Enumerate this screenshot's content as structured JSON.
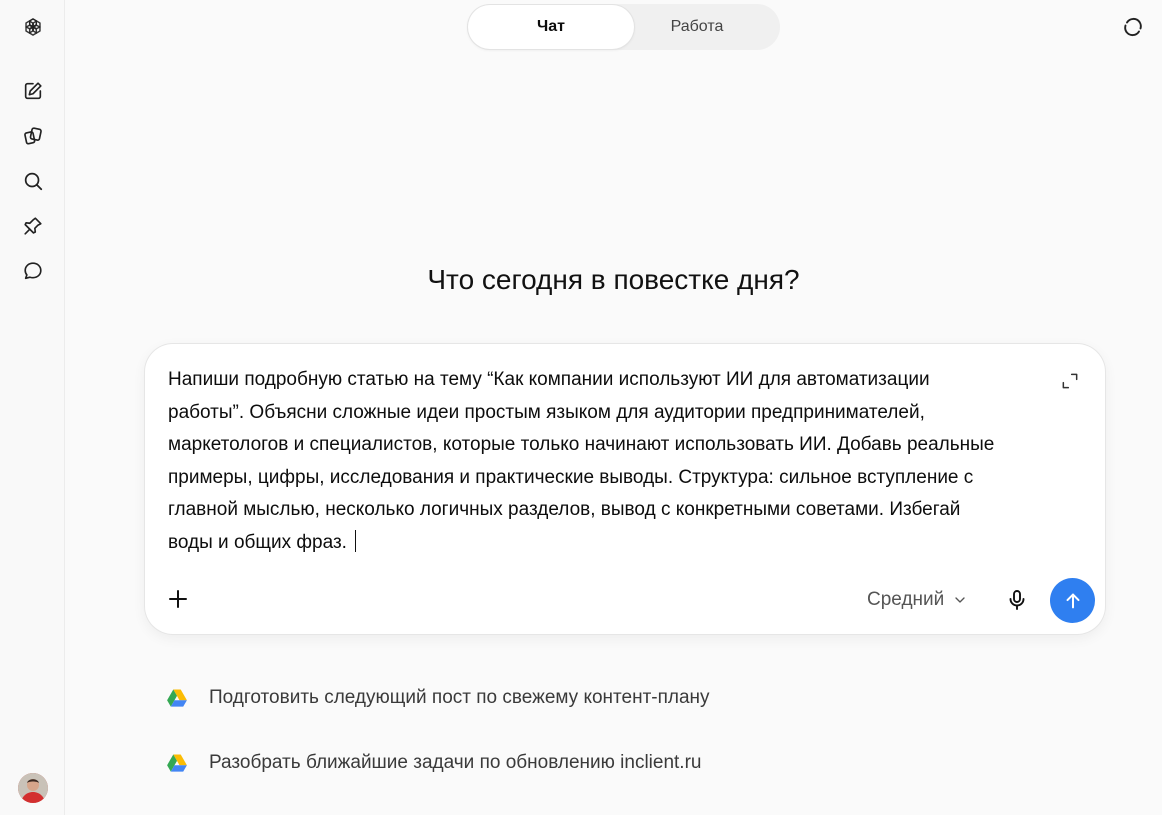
{
  "header": {
    "tabs": [
      {
        "label": "Чат",
        "active": true
      },
      {
        "label": "Работа",
        "active": false
      }
    ]
  },
  "sidebar": {
    "items": [
      {
        "icon": "logo-icon"
      },
      {
        "icon": "new-chat-icon"
      },
      {
        "icon": "apps-icon"
      },
      {
        "icon": "search-icon"
      },
      {
        "icon": "pin-icon"
      },
      {
        "icon": "chat-bubble-icon"
      }
    ]
  },
  "main": {
    "headline": "Что сегодня в повестке дня?",
    "composer": {
      "text_lines": [
        "Напиши подробную статью на тему “Как компании используют ИИ для автоматизации",
        "работы”. Объясни сложные идеи простым языком для аудитории предпринимателей,",
        "маркетологов и специалистов, которые только начинают использовать ИИ. Добавь реальные",
        "примеры, цифры, исследования и практические выводы. Структура: сильное вступление с",
        "главной мыслью, несколько логичных разделов, вывод с конкретными советами. Избегай",
        "воды и общих фраз."
      ],
      "model": "Средний"
    },
    "suggestions": [
      {
        "label": "Подготовить следующий пост по свежему контент-плану",
        "icon": "drive-icon"
      },
      {
        "label": "Разобрать ближайшие задачи по обновлению inclient.ru",
        "icon": "drive-icon"
      }
    ]
  },
  "colors": {
    "accent": "#2f7ff0",
    "background": "#fafafa"
  }
}
